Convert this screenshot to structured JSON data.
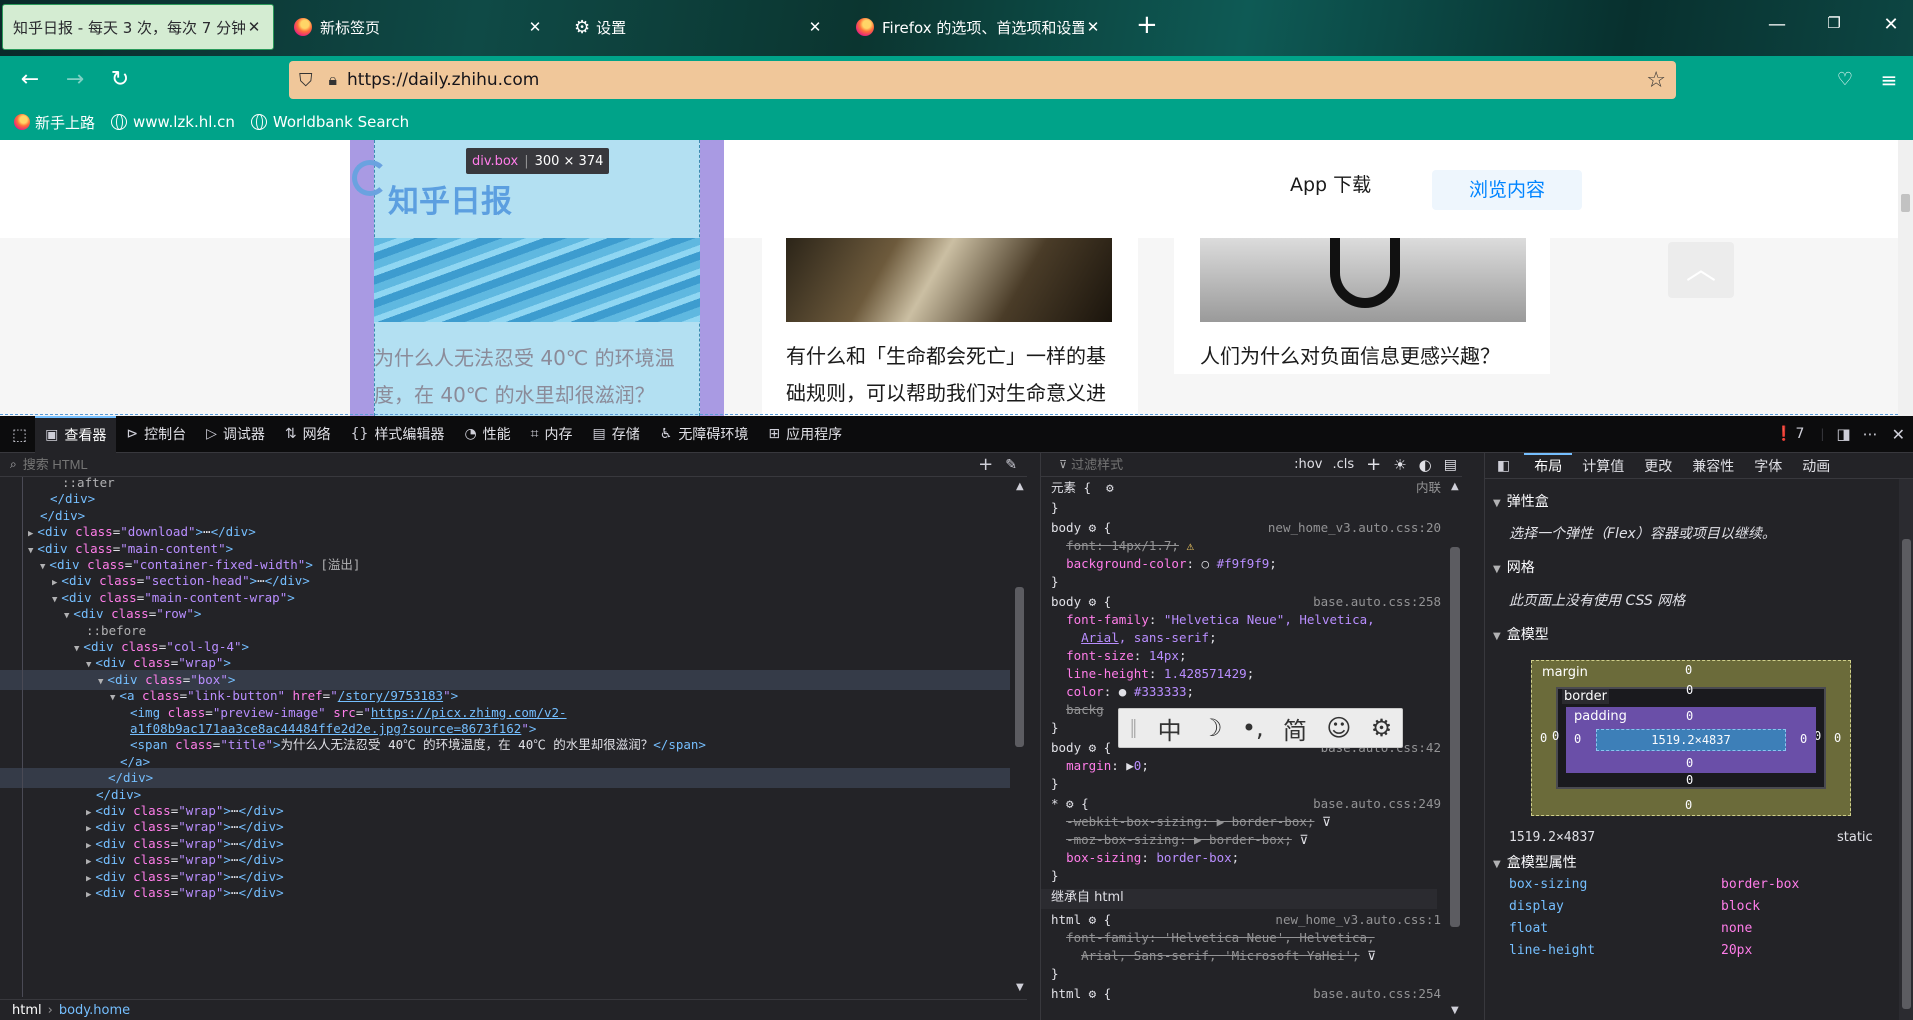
{
  "tabs": [
    {
      "title": "知乎日报 - 每天 3 次，每次 7 分钟",
      "selected": true
    },
    {
      "title": "新标签页",
      "icon": "firefox-icon"
    },
    {
      "title": "设置",
      "icon": "gear-icon"
    },
    {
      "title": "Firefox 的选项、首选项和设置",
      "icon": "firefox-icon"
    }
  ],
  "new_tab": "+",
  "url": "https://daily.zhihu.com",
  "bookmarks": [
    "新手上路",
    "www.lzk.hl.cn",
    "Worldbank Search"
  ],
  "page": {
    "logo": "知乎日报",
    "app_download": "App 下载",
    "browse": "浏览内容",
    "inspector_badge_tag": "div.box",
    "inspector_badge_size": "300 × 374",
    "cards": [
      "为什么人无法忍受 40℃ 的环境温度，在 40℃ 的水里却很滋润？",
      "有什么和「生命都会死亡」一样的基础规则，可以帮助我们对生命意义进",
      "人们为什么对负面信息更感兴趣？"
    ]
  },
  "devtools": {
    "tabs": [
      "查看器",
      "控制台",
      "调试器",
      "网络",
      "样式编辑器",
      "性能",
      "内存",
      "存储",
      "无障碍环境",
      "应用程序"
    ],
    "error_count": "7",
    "search_placeholder": "搜索 HTML",
    "filter_placeholder": "过滤样式",
    "hov": ":hov",
    "cls": ".cls",
    "markup_lines": [
      {
        "indent": 62,
        "html": "<span class='ps'>::after</span>"
      },
      {
        "indent": 50,
        "html": "<span class='tg'>&lt;/div&gt;</span>"
      },
      {
        "indent": 40,
        "html": "<span class='tg'>&lt;/div&gt;</span>"
      },
      {
        "indent": 40,
        "tw": "▶",
        "html": "<span class='tg'>&lt;div </span><span class='at'>class</span>=<span class='av'>\"download\"</span><span class='tg'>&gt;</span>⋯<span class='tg'>&lt;/div&gt;</span>"
      },
      {
        "indent": 40,
        "tw": "▼",
        "html": "<span class='tg'>&lt;div </span><span class='at'>class</span>=<span class='av'>\"main-content\"</span><span class='tg'>&gt;</span>"
      },
      {
        "indent": 52,
        "tw": "▼",
        "html": "<span class='tg'>&lt;div </span><span class='at'>class</span>=<span class='av'>\"container-fixed-width\"</span><span class='tg'>&gt;</span> <span class='ps'>[溢出]</span>"
      },
      {
        "indent": 64,
        "tw": "▶",
        "html": "<span class='tg'>&lt;div </span><span class='at'>class</span>=<span class='av'>\"section-head\"</span><span class='tg'>&gt;</span>⋯<span class='tg'>&lt;/div&gt;</span>"
      },
      {
        "indent": 64,
        "tw": "▼",
        "html": "<span class='tg'>&lt;div </span><span class='at'>class</span>=<span class='av'>\"main-content-wrap\"</span><span class='tg'>&gt;</span>"
      },
      {
        "indent": 76,
        "tw": "▼",
        "html": "<span class='tg'>&lt;div </span><span class='at'>class</span>=<span class='av'>\"row\"</span><span class='tg'>&gt;</span>"
      },
      {
        "indent": 86,
        "html": "<span class='ps'>::before</span>"
      },
      {
        "indent": 86,
        "tw": "▼",
        "html": "<span class='tg'>&lt;div </span><span class='at'>class</span>=<span class='av'>\"col-lg-4\"</span><span class='tg'>&gt;</span>"
      },
      {
        "indent": 98,
        "tw": "▼",
        "html": "<span class='tg'>&lt;div </span><span class='at'>class</span>=<span class='av'>\"wrap\"</span><span class='tg'>&gt;</span>"
      },
      {
        "indent": 110,
        "tw": "▼",
        "sel": true,
        "html": "<span class='tg'>&lt;div </span><span class='at'>class</span>=<span class='av'>\"box\"</span><span class='tg'>&gt;</span>"
      },
      {
        "indent": 122,
        "tw": "▼",
        "html": "<span class='tg'>&lt;a </span><span class='at'>class</span>=<span class='av'>\"link-button\"</span> <span class='at'>href</span>=<span class='av'>\"<span class='lk'>/story/9753183</span>\"</span><span class='tg'>&gt;</span>"
      },
      {
        "indent": 130,
        "html": "<span class='tg'>&lt;img </span><span class='at'>class</span>=<span class='av'>\"preview-image\"</span> <span class='at'>src</span>=<span class='av'>\"<span class='lk'>https://picx.zhimg.com/v2-</span></span>"
      },
      {
        "indent": 130,
        "html": "<span class='av'><span class='lk'>a1f08b9ac171aa3ce8ac44484ffe2d2e.jpg?source=8673f162</span>\"</span><span class='tg'>&gt;</span>"
      },
      {
        "indent": 130,
        "html": "<span class='tg'>&lt;span </span><span class='at'>class</span>=<span class='av'>\"title\"</span><span class='tg'>&gt;</span>为什么人无法忍受 40℃ 的环境温度，在 40℃ 的水里却很滋润？<span class='tg'>&lt;/span&gt;</span>"
      },
      {
        "indent": 120,
        "html": "<span class='tg'>&lt;/a&gt;</span>"
      },
      {
        "indent": 108,
        "sel2": true,
        "html": "<span class='tg'>&lt;/div&gt;</span>"
      },
      {
        "indent": 96,
        "html": "<span class='tg'>&lt;/div&gt;</span>"
      },
      {
        "indent": 98,
        "tw": "▶",
        "html": "<span class='tg'>&lt;div </span><span class='at'>class</span>=<span class='av'>\"wrap\"</span><span class='tg'>&gt;</span>⋯<span class='tg'>&lt;/div&gt;</span>"
      },
      {
        "indent": 98,
        "tw": "▶",
        "html": "<span class='tg'>&lt;div </span><span class='at'>class</span>=<span class='av'>\"wrap\"</span><span class='tg'>&gt;</span>⋯<span class='tg'>&lt;/div&gt;</span>"
      },
      {
        "indent": 98,
        "tw": "▶",
        "html": "<span class='tg'>&lt;div </span><span class='at'>class</span>=<span class='av'>\"wrap\"</span><span class='tg'>&gt;</span>⋯<span class='tg'>&lt;/div&gt;</span>"
      },
      {
        "indent": 98,
        "tw": "▶",
        "html": "<span class='tg'>&lt;div </span><span class='at'>class</span>=<span class='av'>\"wrap\"</span><span class='tg'>&gt;</span>⋯<span class='tg'>&lt;/div&gt;</span>"
      },
      {
        "indent": 98,
        "tw": "▶",
        "html": "<span class='tg'>&lt;div </span><span class='at'>class</span>=<span class='av'>\"wrap\"</span><span class='tg'>&gt;</span>⋯<span class='tg'>&lt;/div&gt;</span>"
      },
      {
        "indent": 98,
        "tw": "▶",
        "html": "<span class='tg'>&lt;div </span><span class='at'>class</span>=<span class='av'>\"wrap\"</span><span class='tg'>&gt;</span>⋯<span class='tg'>&lt;/div&gt;</span>"
      }
    ],
    "breadcrumb": [
      "html",
      "body.home"
    ],
    "rules": [
      {
        "l": "元素 {  ⚙",
        "src": "内联"
      },
      {
        "l": "}"
      },
      {
        "l": "body ⚙ {",
        "src": "new_home_v3.auto.css:20"
      },
      {
        "l": "  <span class='st'>font: 14px/1.7;</span> <span style='color:#ffd567'>⚠</span>"
      },
      {
        "l": "  <span class='pn'>background-color</span>: ○ <span class='pv'>#f9f9f9</span>;"
      },
      {
        "l": "}"
      },
      {
        "l": "body ⚙ {",
        "src": "base.auto.css:258"
      },
      {
        "l": "  <span class='pn'>font-family</span>: <span class='pv'>\"Helvetica Neue\", Helvetica,</span>"
      },
      {
        "l": "    <span class='pv'><u>Arial</u>, sans-serif</span>;"
      },
      {
        "l": "  <span class='pn'>font-size</span>: <span class='pv'>14px</span>;"
      },
      {
        "l": "  <span class='pn'>line-height</span>: <span class='pv'>1.428571429</span>;"
      },
      {
        "l": "  <span class='pn'>color</span>: ● <span class='pv'>#333333</span>;"
      },
      {
        "l": "  <span class='st'>backg</span>"
      },
      {
        "l": "}"
      },
      {
        "l": "body ⚙ {",
        "src": "base.auto.css:42"
      },
      {
        "l": "  <span class='pn'>margin</span>: ▶<span class='pv'>0</span>;"
      },
      {
        "l": "}"
      },
      {
        "l": "* ⚙ {",
        "src": "base.auto.css:249"
      },
      {
        "l": "  <span class='st'>-webkit-box-sizing: ▶ border-box;</span> ⊽"
      },
      {
        "l": "  <span class='st'>-moz-box-sizing: ▶ border-box;</span> ⊽"
      },
      {
        "l": "  <span class='pn'>box-sizing</span>: <span class='pv'>border-box</span>;"
      },
      {
        "l": "}"
      },
      {
        "l": "继承自 html",
        "hdr": true
      },
      {
        "l": "html ⚙ {",
        "src": "new_home_v3.auto.css:1"
      },
      {
        "l": "  <span class='st'>font-family: 'Helvetica Neue', Helvetica,</span>"
      },
      {
        "l": "    <span class='st'>Arial, Sans-serif, 'Microsoft YaHei';</span> ⊽"
      },
      {
        "l": "}"
      },
      {
        "l": "html ⚙ {",
        "src": "base.auto.css:254"
      }
    ],
    "layout_tabs": [
      "布局",
      "计算值",
      "更改",
      "兼容性",
      "字体",
      "动画"
    ],
    "flex_title": "弹性盒",
    "flex_note": "选择一个弹性（Flex）容器或项目以继续。",
    "grid_title": "网格",
    "grid_note": "此页面上没有使用 CSS 网格",
    "boxmodel_title": "盒模型",
    "bm": {
      "margin": "margin",
      "border": "border",
      "padding": "padding",
      "content": "1519.2×4837",
      "zero": "0"
    },
    "bm_size": "1519.2×4837",
    "bm_position": "static",
    "props_title": "盒模型属性",
    "props": [
      {
        "k": "box-sizing",
        "v": "border-box"
      },
      {
        "k": "display",
        "v": "block"
      },
      {
        "k": "float",
        "v": "none"
      },
      {
        "k": "line-height",
        "v": "20px"
      }
    ]
  },
  "ime": [
    "中",
    "☽",
    "•,",
    "简",
    "☺",
    "⚙"
  ]
}
